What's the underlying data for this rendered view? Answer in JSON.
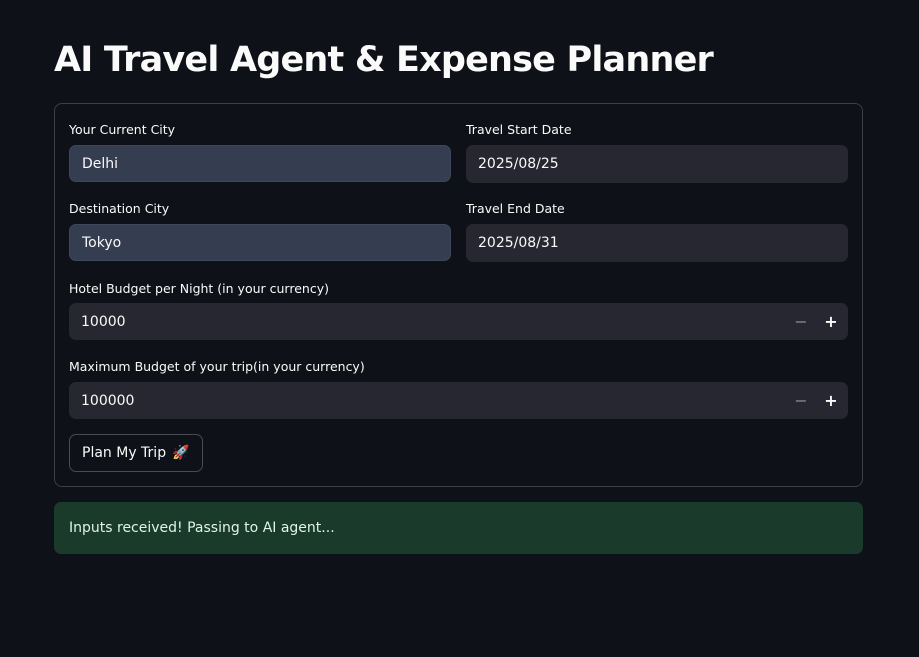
{
  "header": {
    "title": "AI Travel Agent & Expense Planner"
  },
  "form": {
    "current_city": {
      "label": "Your Current City",
      "value": "Delhi"
    },
    "start_date": {
      "label": "Travel Start Date",
      "value": "2025/08/25"
    },
    "destination_city": {
      "label": "Destination City",
      "value": "Tokyo"
    },
    "end_date": {
      "label": "Travel End Date",
      "value": "2025/08/31"
    },
    "hotel_budget": {
      "label": "Hotel Budget per Night (in your currency)",
      "value": "10000",
      "minus": "−",
      "plus": "+"
    },
    "max_budget": {
      "label": "Maximum Budget of your trip(in your currency)",
      "value": "100000",
      "minus": "−",
      "plus": "+"
    },
    "submit": {
      "label": "Plan My Trip",
      "icon": "🚀"
    }
  },
  "alert": {
    "message": "Inputs received! Passing to AI agent..."
  }
}
